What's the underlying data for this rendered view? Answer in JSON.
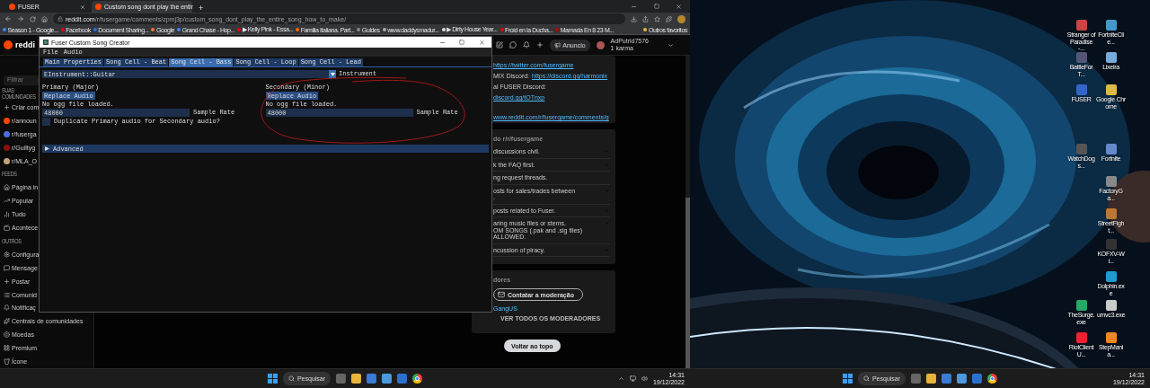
{
  "browser": {
    "tabs": [
      {
        "title": "FUSER",
        "selected": false
      },
      {
        "title": "Custom song dont play the entir",
        "selected": true
      }
    ],
    "new_tab": "+",
    "address": "reddit.com/r/fusergame/comments/zpmj3p/custom_song_dont_play_the_entire_song_how_to_make/",
    "bookmarks": [
      "Season 1 - Google...",
      "Facebook",
      "Document Sharing...",
      "Google",
      "Grand Chase - Hop...",
      "▶ Kelly Pink - Essa...",
      "Familia Italiana. Part...",
      "Guides",
      "www.daddysmadur...",
      "▶ Dirty House Year...",
      "Froid en la Ducha...",
      "Mamada En 8 23 M..."
    ],
    "other_bookmarks": "Outros favoritos"
  },
  "reddit": {
    "brand": "reddi",
    "filter_placeholder": "Filtrar",
    "sidebar": [
      {
        "heading": "SUAS COMUNIDADES",
        "items": [
          {
            "kind": "action",
            "label": "Criar com"
          },
          {
            "kind": "community",
            "label": "r/announ",
            "color": "#ff4500"
          },
          {
            "kind": "community",
            "label": "r/fuserga",
            "color": "#4a6fe0"
          },
          {
            "kind": "community",
            "label": "r/Guiltyg",
            "color": "#8a1010"
          },
          {
            "kind": "community",
            "label": "r/MLA_O",
            "color": "#c9a27a"
          }
        ]
      },
      {
        "heading": "FEEDS",
        "items": [
          {
            "kind": "link",
            "label": "Página in"
          },
          {
            "kind": "link",
            "label": "Popular"
          },
          {
            "kind": "link",
            "label": "Tudo"
          },
          {
            "kind": "link",
            "label": "Acontece"
          }
        ]
      },
      {
        "heading": "OUTROS",
        "items": [
          {
            "kind": "link",
            "label": "Configura"
          },
          {
            "kind": "link",
            "label": "Mensage"
          },
          {
            "kind": "link",
            "label": "Postar"
          },
          {
            "kind": "link",
            "label": "Comunid"
          },
          {
            "kind": "link",
            "label": "Notificaç"
          },
          {
            "kind": "link",
            "label": "Centrais de comunidades"
          },
          {
            "kind": "link",
            "label": "Moedas"
          },
          {
            "kind": "link",
            "label": "Premium"
          },
          {
            "kind": "link",
            "label": "Ícone"
          }
        ]
      }
    ],
    "header": {
      "ad_button": "Anuncio",
      "username": "AdPutrid7576",
      "karma": "1 karma"
    },
    "about_lines": [
      {
        "link": "https://twitter.com/fusergame"
      },
      {
        "text": "MIX Discord:",
        "link": "https://discord.gg/harmonix"
      },
      {
        "text": "al FUSER Discord:"
      },
      {
        "link": "discord.gg/tOTnxp"
      },
      {
        "link": "www.reddit.com/r/fusergame/comments/g"
      }
    ],
    "rules": {
      "title": "do r/r/fusergame",
      "items": [
        {
          "text": "discussions civil.",
          "expandable": true
        },
        {
          "text": "k the FAQ first.",
          "expandable": true
        },
        {
          "text": "ng request threads.",
          "expandable": false
        },
        {
          "text": "osts for sales/trades between\n.",
          "expandable": true
        },
        {
          "text": "posts related to Fuser.",
          "expandable": true
        },
        {
          "text": "aring music files or stems.\nOM SONGS (.pak and .sig files)\nALLOWED.",
          "expandable": true
        },
        {
          "text": "ncussion of piracy.",
          "expandable": true
        }
      ]
    },
    "moderators": {
      "title": "dores",
      "contact": "Contatar a moderação",
      "moderator": "GangUS",
      "view_all": "VER TODOS OS MODERADORES"
    },
    "back_to_top": "Voltar ao topo"
  },
  "app": {
    "title": "Fuser Custom Song Creator",
    "menu": [
      "File",
      "Audio"
    ],
    "tabs": [
      {
        "label": "Main Properties",
        "selected": false
      },
      {
        "label": "Song Cell - Beat",
        "selected": false
      },
      {
        "label": "Song Cell - Bass",
        "selected": true
      },
      {
        "label": "Song Cell - Loop",
        "selected": false
      },
      {
        "label": "Song Cell - Lead",
        "selected": false
      }
    ],
    "instrument": {
      "value": "EInstrument::Guitar",
      "label": "Instrument"
    },
    "columns": [
      {
        "heading": "Primary (Major)",
        "button": "Replace Audio",
        "status": "No ogg file loaded.",
        "sample_rate": "48000",
        "sample_rate_label": "Sample Rate",
        "checkbox": {
          "label": "Duplicate Primary audio for Secondary audio?",
          "checked": false
        }
      },
      {
        "heading": "Secondary (Minor)",
        "button": "Replace Audio",
        "status": "No ogg file loaded.",
        "sample_rate": "48000",
        "sample_rate_label": "Sample Rate"
      }
    ],
    "advanced": {
      "label": "Advanced",
      "expanded": false
    }
  },
  "desktop_icons": [
    "Stranger of Paradise -...",
    "FortniteClie...",
    "BattleForT...",
    "Lixeira",
    "FUSER",
    "Google Chrome",
    "WatchDogs...",
    "Fortnite",
    "FactoryGa...",
    "StreetFight...",
    "KOFXV-Wi...",
    "Dolphin.exe",
    "TheSurge.exe",
    "umvc3.exe",
    "RiotClientU...",
    "StepMania..."
  ],
  "taskbars": [
    {
      "search": "Pesquisar",
      "time": "14:31",
      "date": "19/12/2022"
    },
    {
      "search": "Pesquisar",
      "time": "14:31",
      "date": "19/12/2022"
    }
  ]
}
